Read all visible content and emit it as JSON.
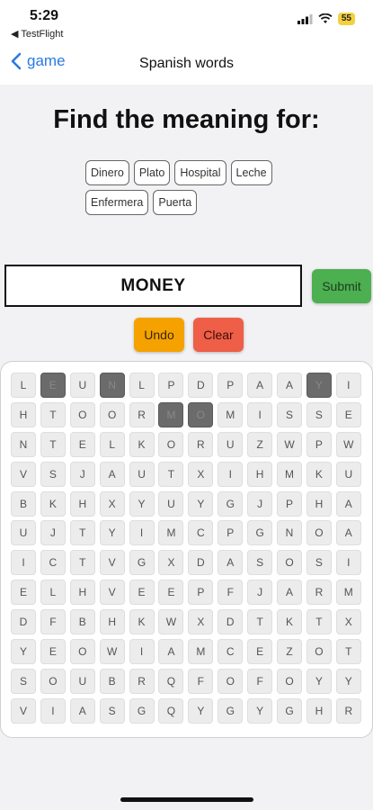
{
  "status_bar": {
    "time": "5:29",
    "back_app": "TestFlight",
    "battery": "55",
    "accent": "#f4d03f"
  },
  "nav": {
    "back_label": "game",
    "title": "Spanish words",
    "back_color": "#2a7ae2"
  },
  "heading": "Find the meaning for:",
  "words": [
    "Dinero",
    "Plato",
    "Hospital",
    "Leche",
    "Enfermera",
    "Puerta"
  ],
  "answer": {
    "value": "MONEY"
  },
  "buttons": {
    "submit": {
      "label": "Submit",
      "color": "#4caf50"
    },
    "undo": {
      "label": "Undo",
      "color": "#f5a200"
    },
    "clear": {
      "label": "Clear",
      "color": "#ef5e47"
    }
  },
  "grid": {
    "rows": [
      [
        "L",
        "E",
        "U",
        "N",
        "L",
        "P",
        "D",
        "P",
        "A",
        "A",
        "Y",
        "I"
      ],
      [
        "H",
        "T",
        "O",
        "O",
        "R",
        "M",
        "O",
        "M",
        "I",
        "S",
        "S",
        "E"
      ],
      [
        "N",
        "T",
        "E",
        "L",
        "K",
        "O",
        "R",
        "U",
        "Z",
        "W",
        "P",
        "W"
      ],
      [
        "V",
        "S",
        "J",
        "A",
        "U",
        "T",
        "X",
        "I",
        "H",
        "M",
        "K",
        "U"
      ],
      [
        "B",
        "K",
        "H",
        "X",
        "Y",
        "U",
        "Y",
        "G",
        "J",
        "P",
        "H",
        "A"
      ],
      [
        "U",
        "J",
        "T",
        "Y",
        "I",
        "M",
        "C",
        "P",
        "G",
        "N",
        "O",
        "A"
      ],
      [
        "I",
        "C",
        "T",
        "V",
        "G",
        "X",
        "D",
        "A",
        "S",
        "O",
        "S",
        "I"
      ],
      [
        "E",
        "L",
        "H",
        "V",
        "E",
        "E",
        "P",
        "F",
        "J",
        "A",
        "R",
        "M"
      ],
      [
        "D",
        "F",
        "B",
        "H",
        "K",
        "W",
        "X",
        "D",
        "T",
        "K",
        "T",
        "X"
      ],
      [
        "Y",
        "E",
        "O",
        "W",
        "I",
        "A",
        "M",
        "C",
        "E",
        "Z",
        "O",
        "T"
      ],
      [
        "S",
        "O",
        "U",
        "B",
        "R",
        "Q",
        "F",
        "O",
        "F",
        "O",
        "Y",
        "Y"
      ],
      [
        "V",
        "I",
        "A",
        "S",
        "G",
        "Q",
        "Y",
        "G",
        "Y",
        "G",
        "H",
        "R"
      ]
    ],
    "selected": [
      [
        0,
        1
      ],
      [
        0,
        3
      ],
      [
        0,
        10
      ],
      [
        1,
        5
      ],
      [
        1,
        6
      ]
    ],
    "selected_color": "#6b6b6b"
  }
}
